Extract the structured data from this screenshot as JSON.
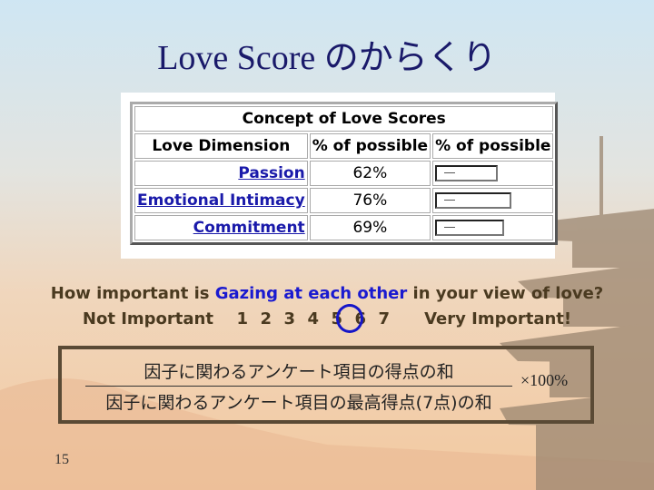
{
  "slide": {
    "title": "Love Score のからくり",
    "page_number": "15"
  },
  "table": {
    "caption": "Concept of Love Scores",
    "headers": [
      "Love Dimension",
      "% of possible",
      "% of possible"
    ],
    "rows": [
      {
        "dimension": "Passion",
        "percent": "62%",
        "bar_value": 62
      },
      {
        "dimension": "Emotional Intimacy",
        "percent": "76%",
        "bar_value": 76
      },
      {
        "dimension": "Commitment",
        "percent": "69%",
        "bar_value": 69
      }
    ]
  },
  "question": {
    "prefix": "How important is ",
    "highlight": "Gazing at each other",
    "suffix": " in your view of love?",
    "low_label": "Not Important",
    "high_label": "Very Important!",
    "scale": [
      "1",
      "2",
      "3",
      "4",
      "5",
      "6",
      "7"
    ],
    "selected": "5",
    "highlight_color": "#1a1ad0"
  },
  "formula": {
    "numerator": "因子に関わるアンケート項目の得点の和",
    "denominator": "因子に関わるアンケート項目の最高得点(7点)の和",
    "multiplier": "×100%"
  }
}
